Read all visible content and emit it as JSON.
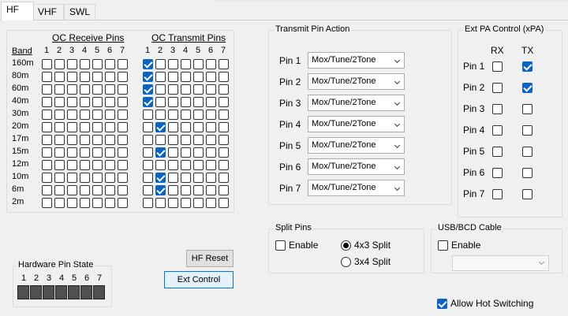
{
  "tabs": [
    "HF",
    "VHF",
    "SWL"
  ],
  "oc_group": {
    "band_header": "Band",
    "receive_header": "OC Receive Pins",
    "transmit_header": "OC Transmit Pins",
    "pin_numbers": [
      "1",
      "2",
      "3",
      "4",
      "5",
      "6",
      "7"
    ],
    "bands": [
      "160m",
      "80m",
      "60m",
      "40m",
      "30m",
      "20m",
      "17m",
      "15m",
      "12m",
      "10m",
      "6m",
      "2m"
    ],
    "receive_checked": [
      [],
      [],
      [],
      [],
      [],
      [],
      [],
      [],
      [],
      [],
      [],
      []
    ],
    "transmit_checked": [
      [
        1
      ],
      [
        1
      ],
      [
        1
      ],
      [
        1
      ],
      [],
      [
        2
      ],
      [],
      [
        2
      ],
      [],
      [
        2
      ],
      [
        2
      ],
      []
    ]
  },
  "transmit_pin_action": {
    "title": "Transmit Pin Action",
    "pins": [
      {
        "label": "Pin 1",
        "value": "Mox/Tune/2Tone"
      },
      {
        "label": "Pin 2",
        "value": "Mox/Tune/2Tone"
      },
      {
        "label": "Pin 3",
        "value": "Mox/Tune/2Tone"
      },
      {
        "label": "Pin 4",
        "value": "Mox/Tune/2Tone"
      },
      {
        "label": "Pin 5",
        "value": "Mox/Tune/2Tone"
      },
      {
        "label": "Pin 6",
        "value": "Mox/Tune/2Tone"
      },
      {
        "label": "Pin 7",
        "value": "Mox/Tune/2Tone"
      }
    ]
  },
  "ext_pa": {
    "title": "Ext PA Control (xPA)",
    "rx_header": "RX",
    "tx_header": "TX",
    "pins": [
      {
        "label": "Pin 1",
        "rx": false,
        "tx": true
      },
      {
        "label": "Pin 2",
        "rx": false,
        "tx": true
      },
      {
        "label": "Pin 3",
        "rx": false,
        "tx": false
      },
      {
        "label": "Pin 4",
        "rx": false,
        "tx": false
      },
      {
        "label": "Pin 5",
        "rx": false,
        "tx": false
      },
      {
        "label": "Pin 6",
        "rx": false,
        "tx": false
      },
      {
        "label": "Pin 7",
        "rx": false,
        "tx": false
      }
    ]
  },
  "split_pins": {
    "title": "Split Pins",
    "enable_label": "Enable",
    "option_4x3": "4x3 Split",
    "option_3x4": "3x4 Split",
    "selected": "4x3"
  },
  "usb_bcd": {
    "title": "USB/BCD Cable",
    "enable_label": "Enable"
  },
  "hardware_pin_state": {
    "title": "Hardware Pin State",
    "pin_numbers": [
      "1",
      "2",
      "3",
      "4",
      "5",
      "6",
      "7"
    ]
  },
  "buttons": {
    "hf_reset": "HF Reset",
    "ext_control": "Ext Control"
  },
  "allow_hot_switching": {
    "label": "Allow Hot Switching",
    "checked": true
  },
  "colors": {
    "check_blue": "#0a64c8",
    "focus_border": "#0078d7"
  }
}
